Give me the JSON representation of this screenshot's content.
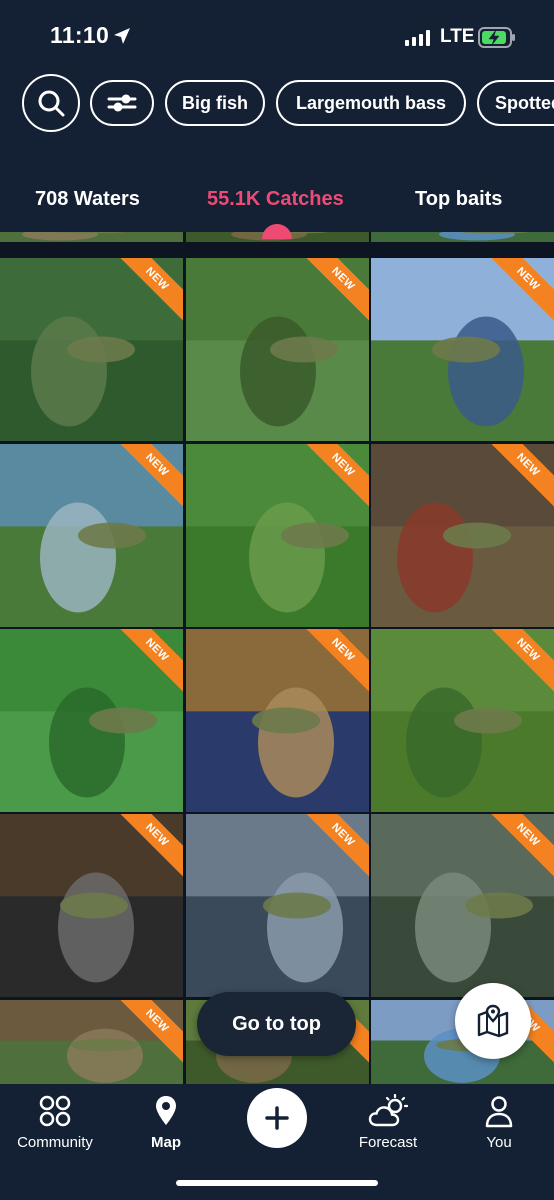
{
  "status": {
    "time": "11:10",
    "network": "LTE",
    "icons": [
      "location-arrow-icon",
      "signal-icon",
      "battery-charging-icon"
    ]
  },
  "filters": {
    "search_icon": "search-icon",
    "settings_icon": "sliders-icon",
    "chips": [
      "Big fish",
      "Largemouth bass",
      "Spotted bass"
    ]
  },
  "tabs": [
    {
      "label": "708 Waters",
      "active": false
    },
    {
      "label": "55.1K Catches",
      "active": true
    },
    {
      "label": "Top baits",
      "active": false
    }
  ],
  "grid": {
    "badge_label": "NEW",
    "rows": 6,
    "columns": 3
  },
  "floating": {
    "go_top_label": "Go to top",
    "map_icon": "map-pin-icon"
  },
  "bottom_nav": [
    {
      "label": "Community",
      "icon": "grid-circles-icon"
    },
    {
      "label": "Map",
      "icon": "map-marker-icon",
      "active": true
    },
    {
      "label": "",
      "icon": "plus-icon"
    },
    {
      "label": "Forecast",
      "icon": "weather-cloud-icon"
    },
    {
      "label": "You",
      "icon": "user-icon"
    }
  ],
  "colors": {
    "background": "#142033",
    "accent": "#ee4b74",
    "badge": "#f58220"
  }
}
